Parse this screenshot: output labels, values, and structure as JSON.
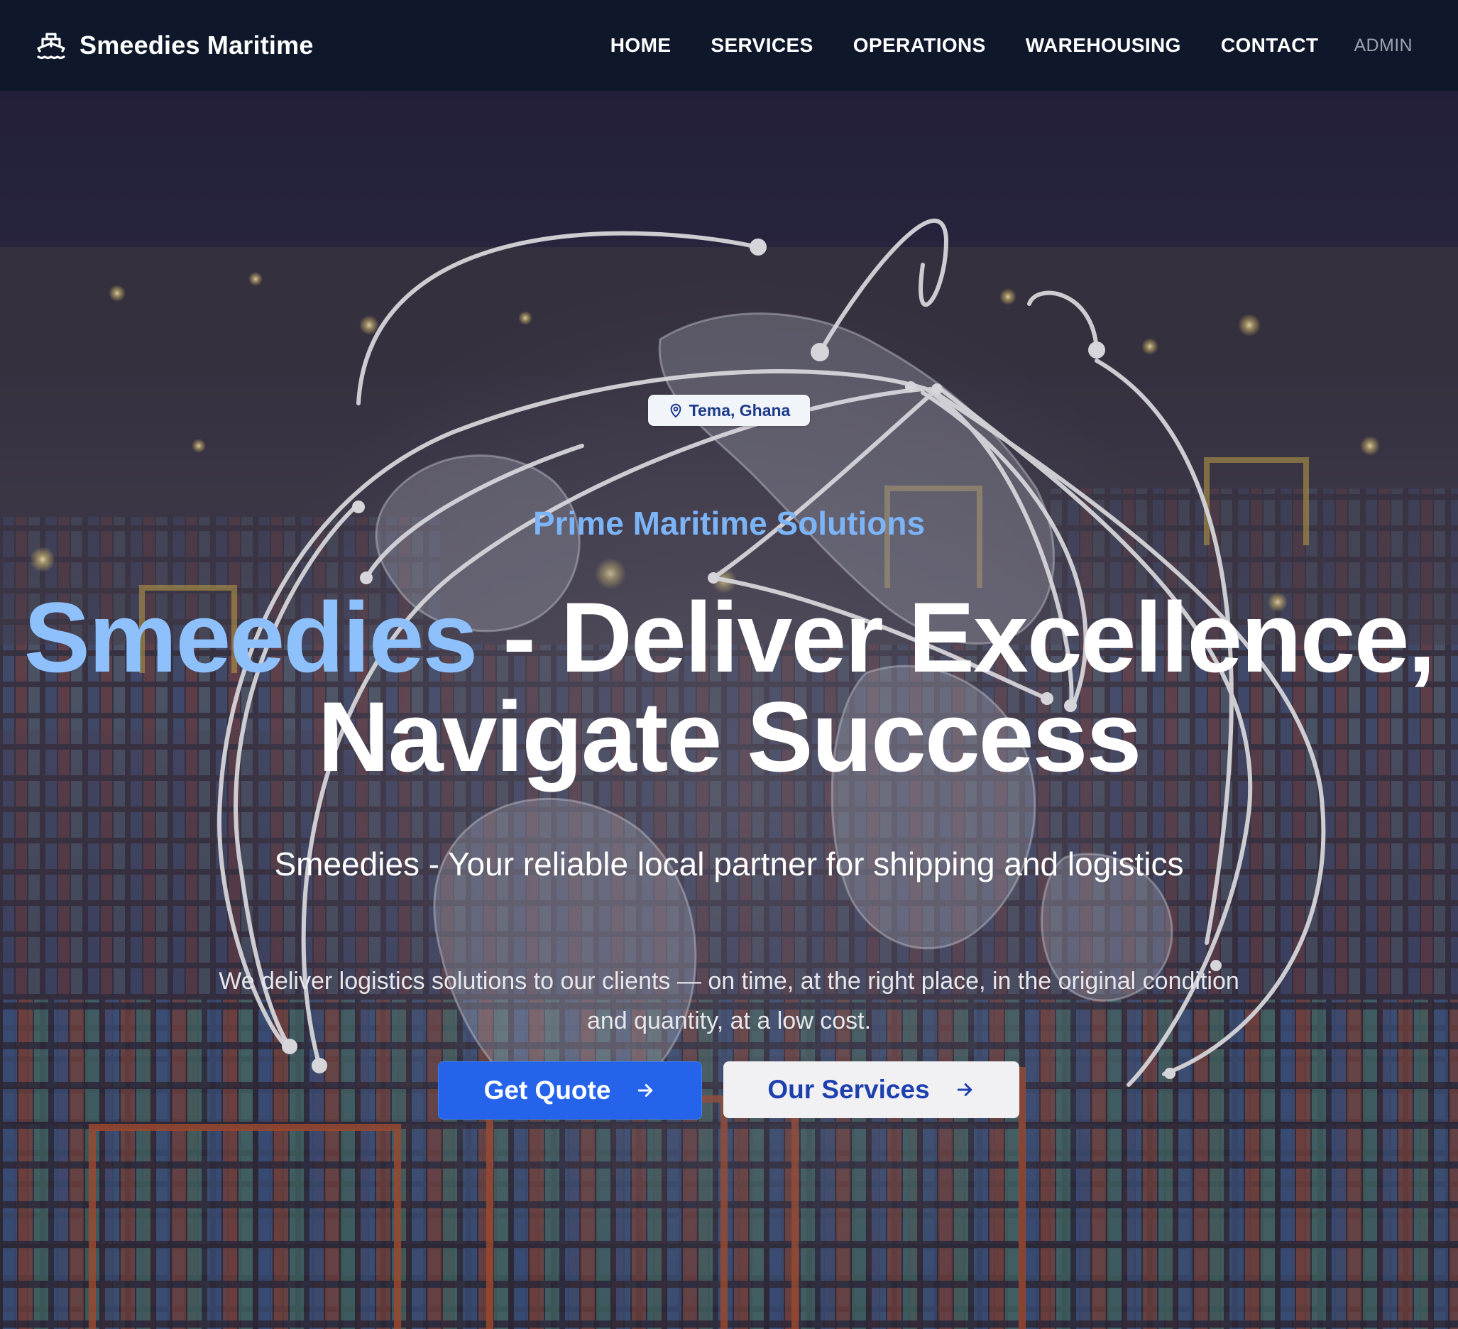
{
  "header": {
    "brand_name": "Smeedies Maritime",
    "brand_icon": "ship-icon",
    "nav": {
      "home": "HOME",
      "services": "SERVICES",
      "operations": "OPERATIONS",
      "warehousing": "WAREHOUSING",
      "contact": "CONTACT",
      "admin": "ADMIN"
    }
  },
  "hero": {
    "location_icon": "map-pin-icon",
    "location": "Tema, Ghana",
    "kicker": "Prime Maritime Solutions",
    "headline_accent": "Smeedies",
    "headline_rest": " - Deliver Excellence,",
    "headline_line2": "Navigate Success",
    "tagline": "Smeedies - Your reliable local partner for shipping and logistics",
    "description": "We deliver logistics solutions to our clients — on time, at the right place, in the original condition and quantity, at a low cost.",
    "primary_button": "Get Quote",
    "secondary_button": "Our Services",
    "button_icon": "arrow-right-icon"
  },
  "colors": {
    "nav_bg": "#0f172a",
    "accent_blue": "#8ec1fb",
    "kicker_blue": "#7cb4f8",
    "primary_button": "#2563eb",
    "secondary_button_text": "#1e40af"
  }
}
